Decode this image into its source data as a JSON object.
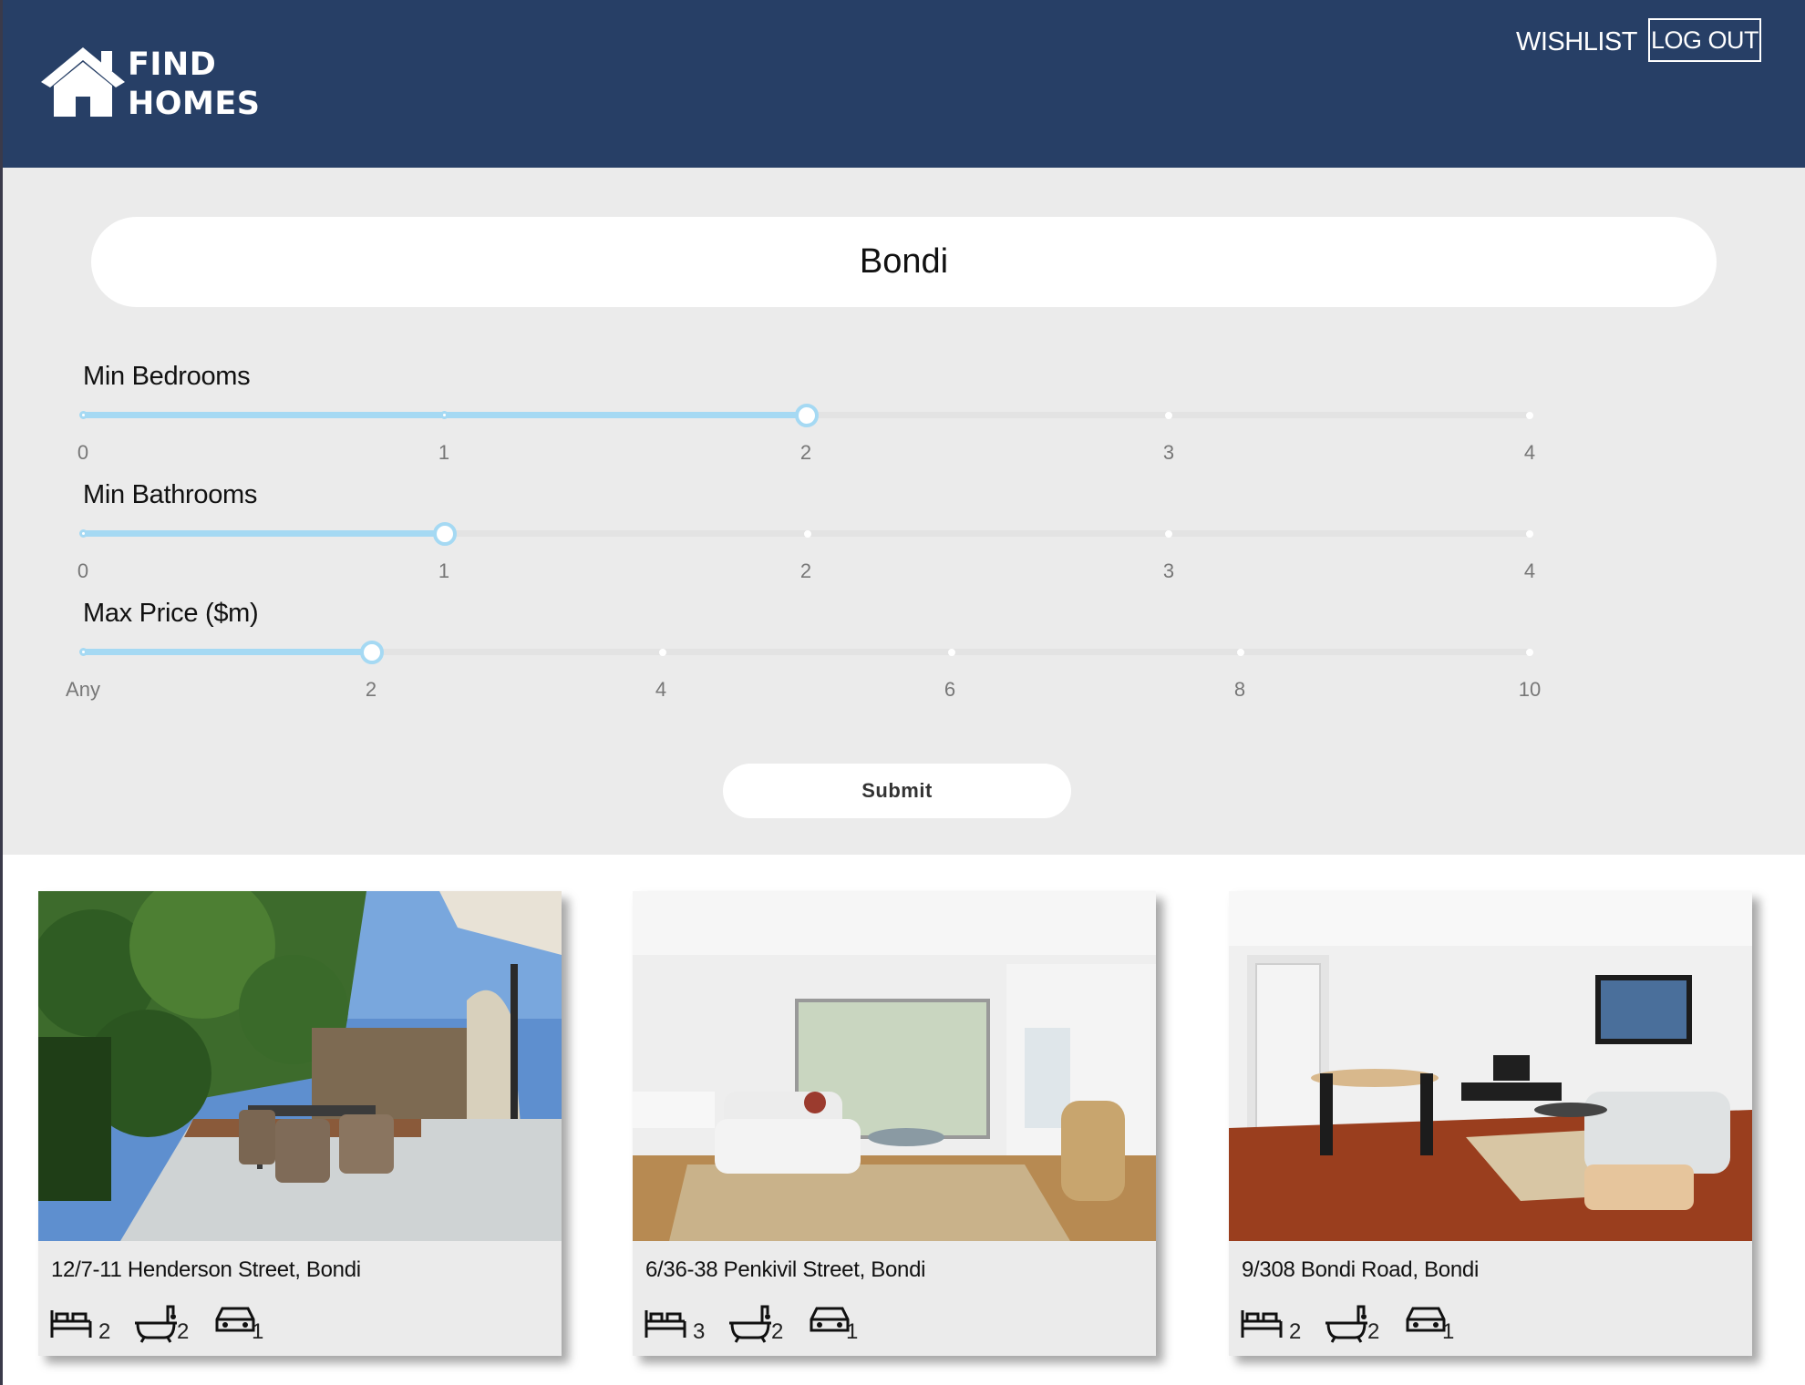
{
  "header": {
    "logo_line1": "FIND",
    "logo_line2": "HOMES",
    "wishlist_label": "WISHLIST",
    "logout_label": "LOG OUT",
    "background": "#273f66"
  },
  "search": {
    "value": "Bondi"
  },
  "sliders": {
    "bedrooms": {
      "label": "Min Bedrooms",
      "ticks": [
        "0",
        "1",
        "2",
        "3",
        "4"
      ],
      "value": 2
    },
    "bathrooms": {
      "label": "Min Bathrooms",
      "ticks": [
        "0",
        "1",
        "2",
        "3",
        "4"
      ],
      "value": 1
    },
    "price": {
      "label": "Max Price ($m)",
      "ticks": [
        "Any",
        "2",
        "4",
        "6",
        "8",
        "10"
      ],
      "value": 2
    }
  },
  "submit_label": "Submit",
  "accent_color": "#a5d9f3",
  "listings": [
    {
      "address": "12/7-11 Henderson Street, Bondi",
      "beds": "2",
      "baths": "2",
      "cars": "1",
      "photo": "patio"
    },
    {
      "address": "6/36-38 Penkivil Street, Bondi",
      "beds": "3",
      "baths": "2",
      "cars": "1",
      "photo": "living-room"
    },
    {
      "address": "9/308 Bondi Road, Bondi",
      "beds": "2",
      "baths": "2",
      "cars": "1",
      "photo": "dining-living"
    }
  ],
  "icons": {
    "beds": "bed-icon",
    "baths": "bathtub-icon",
    "cars": "car-icon"
  }
}
